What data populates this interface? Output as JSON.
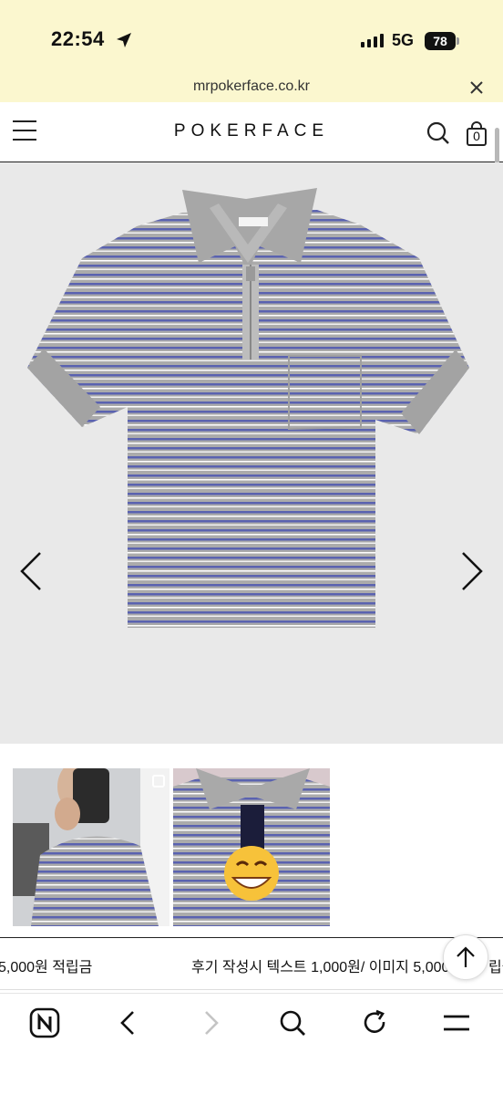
{
  "status": {
    "time": "22:54",
    "network": "5G",
    "battery": "78"
  },
  "browser": {
    "url": "mrpokerface.co.kr"
  },
  "site": {
    "logo": "POKERFACE",
    "cart_count": "0"
  },
  "marquee": {
    "left_text": "5,000원 적립금",
    "middle_text": "후기 작성시 텍스트 1,000원/ 이미지 5,000",
    "right_text": "립금"
  },
  "icons": {
    "location": "location-arrow-icon",
    "close": "close-icon",
    "menu": "hamburger-menu-icon",
    "search": "search-icon",
    "cart": "shopping-bag-icon",
    "prev": "chevron-left-icon",
    "next": "chevron-right-icon",
    "top": "arrow-up-icon",
    "home": "naver-n-icon",
    "back": "back-icon",
    "forward": "forward-icon",
    "reload": "reload-icon",
    "more": "more-menu-icon"
  },
  "colors": {
    "status_bg": "#fbf7cf",
    "stripe_blue": "#5a62b0",
    "shirt_grey": "#a9a9a9"
  }
}
